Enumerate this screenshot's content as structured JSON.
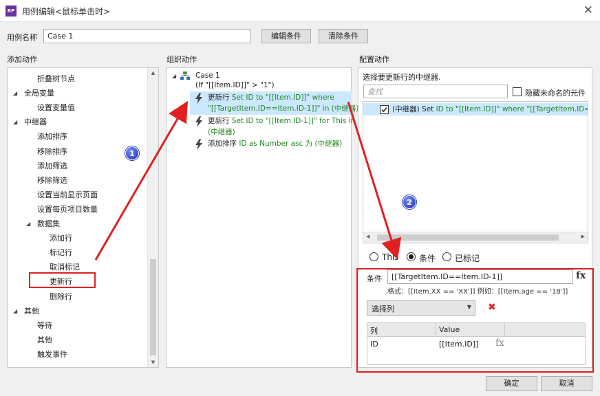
{
  "window": {
    "app_icon": "RP",
    "title": "用例编辑<鼠标单击时>",
    "close_glyph": "✕"
  },
  "case_name": {
    "label": "用例名称",
    "value": "Case 1",
    "edit_condition_button": "编辑条件",
    "clear_condition_button": "清除条件"
  },
  "add_actions": {
    "header": "添加动作",
    "items": [
      {
        "label": "折叠树节点",
        "level": 2
      },
      {
        "label": "全局变量",
        "level": 1,
        "expanded": true
      },
      {
        "label": "设置变量值",
        "level": 2
      },
      {
        "label": "中继器",
        "level": 1,
        "expanded": true
      },
      {
        "label": "添加排序",
        "level": 2
      },
      {
        "label": "移除排序",
        "level": 2
      },
      {
        "label": "添加筛选",
        "level": 2
      },
      {
        "label": "移除筛选",
        "level": 2
      },
      {
        "label": "设置当前显示页面",
        "level": 2
      },
      {
        "label": "设置每页项目数量",
        "level": 2
      },
      {
        "label": "数据集",
        "level": 2,
        "expanded": true
      },
      {
        "label": "添加行",
        "level": 3
      },
      {
        "label": "标记行",
        "level": 3
      },
      {
        "label": "取消标记",
        "level": 3
      },
      {
        "label": "更新行",
        "level": 3,
        "highlighted": true
      },
      {
        "label": "删除行",
        "level": 3
      },
      {
        "label": "其他",
        "level": 1,
        "expanded": true
      },
      {
        "label": "等待",
        "level": 2
      },
      {
        "label": "其他",
        "level": 2
      },
      {
        "label": "触发事件",
        "level": 2
      }
    ]
  },
  "organize_actions": {
    "header": "组织动作",
    "case_title": "Case 1",
    "case_condition": "(If \"[[Item.ID]]\" > \"1\")",
    "actions": [
      {
        "prefix": "更新行",
        "line1": "Set ID to \"[[Item.ID]]\" where",
        "line2": "\"[[TargetItem.ID==Item.ID-1]]\" in (中继器)",
        "selected": true
      },
      {
        "prefix": "更新行",
        "line1": "Set ID to \"[[Item.ID-1]]\" for This in",
        "line2": "(中继器)",
        "selected": false
      },
      {
        "prefix": "添加排序",
        "line1": "ID as Number asc 为 (中继器)",
        "line2": "",
        "selected": false
      }
    ]
  },
  "configure_actions": {
    "header": "配置动作",
    "instruction": "选择要更新行的中继器.",
    "search_placeholder": "查找",
    "hide_unnamed_label": "隐藏未命名的元件",
    "repeater_row": {
      "name": "(中继器)",
      "text_plain": "Set",
      "text_green": "ID to \"[[Item.ID]]\" where \"[[TargetItem.ID==Item.I",
      "checked": true
    },
    "mode_options": [
      {
        "label": "This",
        "selected": false
      },
      {
        "label": "条件",
        "selected": true
      },
      {
        "label": "已标记",
        "selected": false
      }
    ],
    "condition_label": "条件",
    "condition_value": "[[TargetItem.ID==Item.ID-1]]",
    "fx_label": "fx",
    "format_hint": "格式：[[Item.XX == 'XX']] 例如：[[Item.age == '18']]",
    "select_column_label": "选择列",
    "delete_glyph": "✖",
    "table": {
      "headers": [
        "列",
        "Value"
      ],
      "rows": [
        {
          "column": "ID",
          "value": "[[Item.ID]]",
          "fx": "fx"
        }
      ]
    }
  },
  "footer": {
    "ok_button": "确定",
    "cancel_button": "取消"
  },
  "annotations": {
    "badge_1": "1",
    "badge_2": "2",
    "accent_color": "#e02020",
    "selection_color": "#cce8ff"
  },
  "icons": {
    "lightning": "lightning-bolt-icon",
    "case": "case-flow-icon",
    "dropdown": "chevron-down-icon"
  }
}
